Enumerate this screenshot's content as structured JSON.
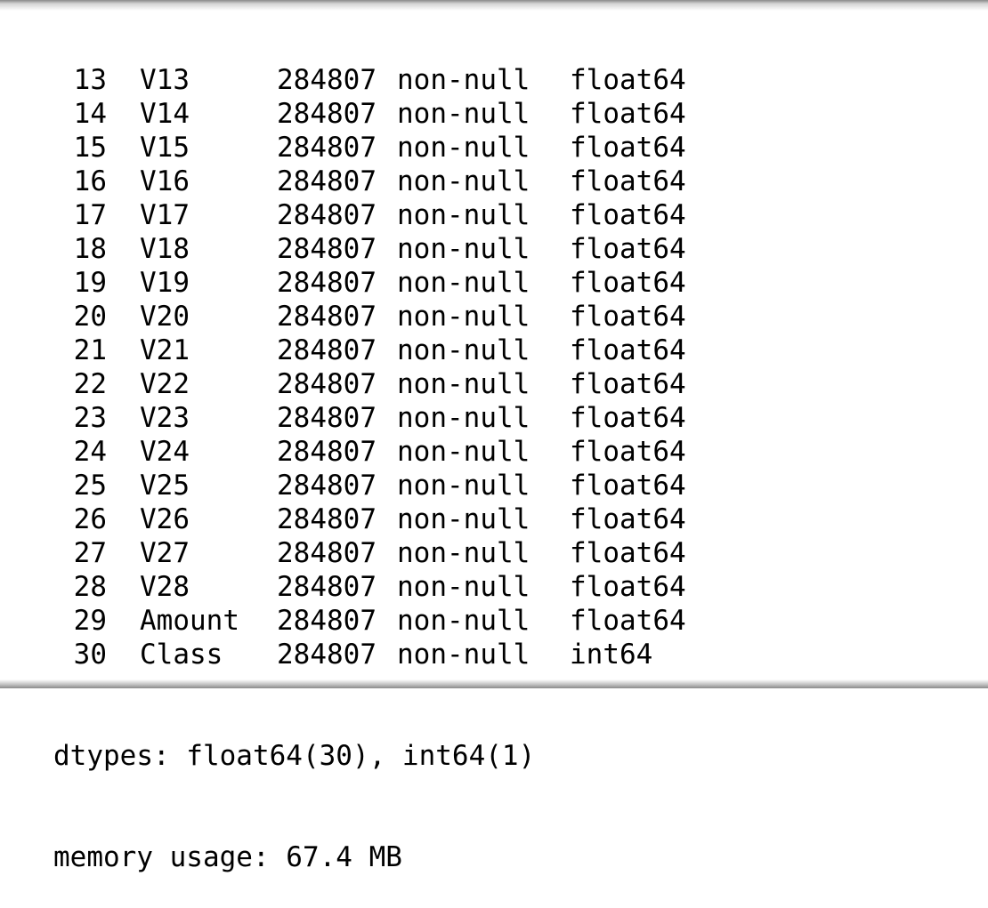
{
  "rows": [
    {
      "index": "13",
      "column": "V13",
      "count": "284807",
      "nonnull": "non-null",
      "dtype": "float64"
    },
    {
      "index": "14",
      "column": "V14",
      "count": "284807",
      "nonnull": "non-null",
      "dtype": "float64"
    },
    {
      "index": "15",
      "column": "V15",
      "count": "284807",
      "nonnull": "non-null",
      "dtype": "float64"
    },
    {
      "index": "16",
      "column": "V16",
      "count": "284807",
      "nonnull": "non-null",
      "dtype": "float64"
    },
    {
      "index": "17",
      "column": "V17",
      "count": "284807",
      "nonnull": "non-null",
      "dtype": "float64"
    },
    {
      "index": "18",
      "column": "V18",
      "count": "284807",
      "nonnull": "non-null",
      "dtype": "float64"
    },
    {
      "index": "19",
      "column": "V19",
      "count": "284807",
      "nonnull": "non-null",
      "dtype": "float64"
    },
    {
      "index": "20",
      "column": "V20",
      "count": "284807",
      "nonnull": "non-null",
      "dtype": "float64"
    },
    {
      "index": "21",
      "column": "V21",
      "count": "284807",
      "nonnull": "non-null",
      "dtype": "float64"
    },
    {
      "index": "22",
      "column": "V22",
      "count": "284807",
      "nonnull": "non-null",
      "dtype": "float64"
    },
    {
      "index": "23",
      "column": "V23",
      "count": "284807",
      "nonnull": "non-null",
      "dtype": "float64"
    },
    {
      "index": "24",
      "column": "V24",
      "count": "284807",
      "nonnull": "non-null",
      "dtype": "float64"
    },
    {
      "index": "25",
      "column": "V25",
      "count": "284807",
      "nonnull": "non-null",
      "dtype": "float64"
    },
    {
      "index": "26",
      "column": "V26",
      "count": "284807",
      "nonnull": "non-null",
      "dtype": "float64"
    },
    {
      "index": "27",
      "column": "V27",
      "count": "284807",
      "nonnull": "non-null",
      "dtype": "float64"
    },
    {
      "index": "28",
      "column": "V28",
      "count": "284807",
      "nonnull": "non-null",
      "dtype": "float64"
    },
    {
      "index": "29",
      "column": "Amount",
      "count": "284807",
      "nonnull": "non-null",
      "dtype": "float64"
    },
    {
      "index": "30",
      "column": "Class",
      "count": "284807",
      "nonnull": "non-null",
      "dtype": "int64"
    }
  ],
  "summary": {
    "dtypes": "dtypes: float64(30), int64(1)",
    "memory": "memory usage: 67.4 MB"
  }
}
